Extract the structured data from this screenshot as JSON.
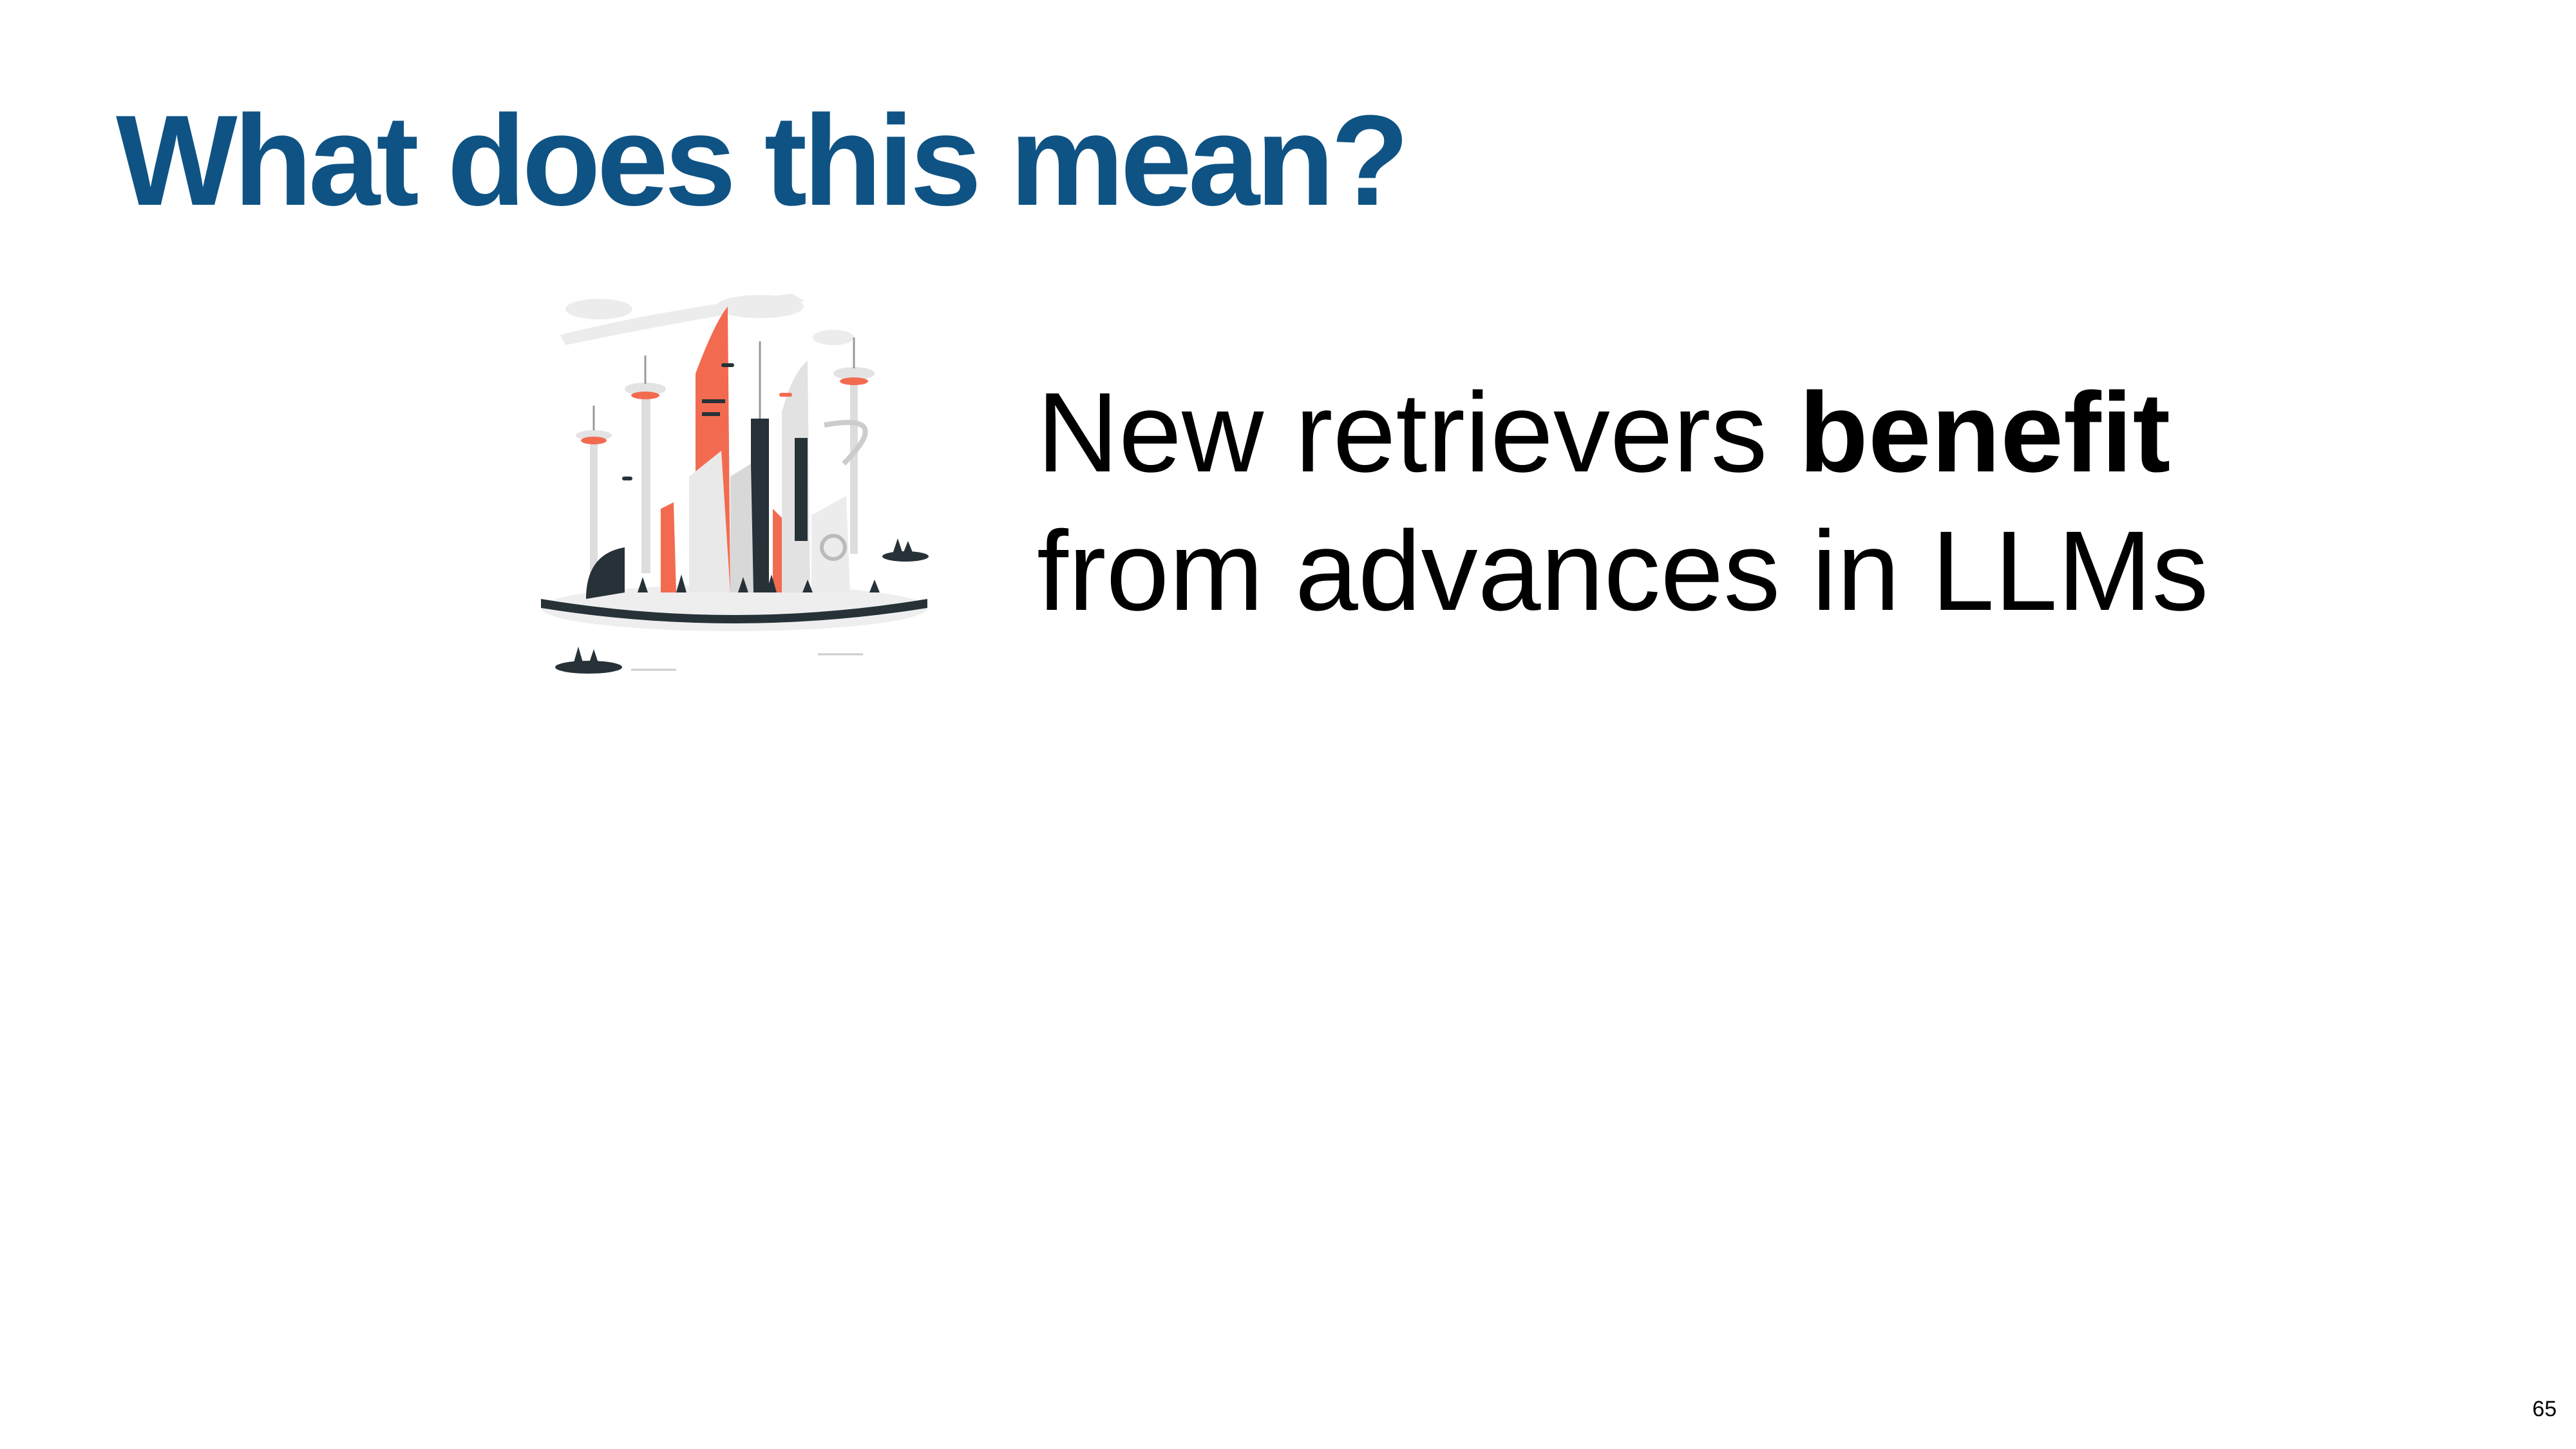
{
  "slide": {
    "title": "What does this mean?",
    "body_line1_plain": "New retrievers ",
    "body_line1_bold": "benefit",
    "body_line2": "from advances in LLMs",
    "page_number": "65"
  },
  "illustration": {
    "subject": "futuristic-city-illustration",
    "colors": {
      "accent": "#F26B50",
      "dark": "#263238",
      "light": "#E6E6E6"
    }
  },
  "colors": {
    "title": "#0F5384",
    "text": "#000000",
    "background": "#FFFFFF"
  }
}
